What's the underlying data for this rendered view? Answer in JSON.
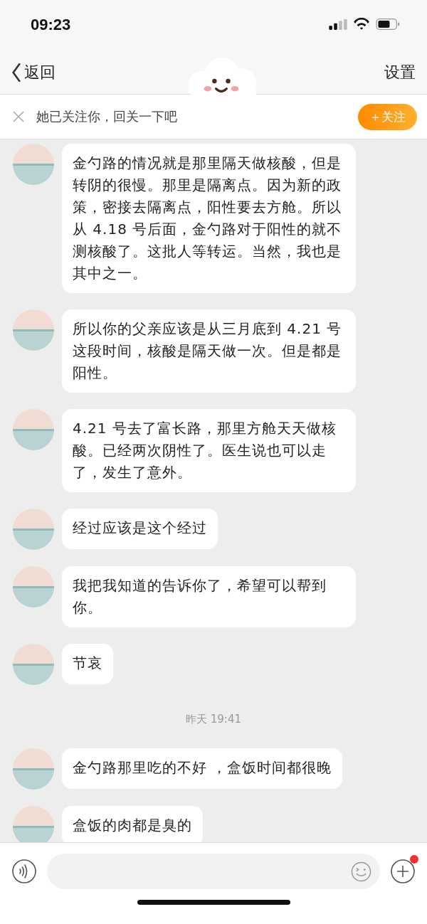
{
  "status_bar": {
    "time": "09:23"
  },
  "nav_bar": {
    "back_label": "返回",
    "settings_label": "设置",
    "title_sticker": true
  },
  "follow_bar": {
    "text": "她已关注你，回关一下吧",
    "button": "＋关注"
  },
  "messages": [
    {
      "kind": "message",
      "text": "金勺路的情况就是那里隔天做核酸，但是转阴的很慢。那里是隔离点。因为新的政策，密接去隔离点，阳性要去方舱。所以从 4.18 号后面，金勺路对于阳性的就不测核酸了。这批人等转运。当然，我也是其中之一。"
    },
    {
      "kind": "message",
      "text": "所以你的父亲应该是从三月底到 4.21 号这段时间，核酸是隔天做一次。但是都是阳性。"
    },
    {
      "kind": "message",
      "text": "4.21 号去了富长路，那里方舱天天做核酸。已经两次阴性了。医生说也可以走了，发生了意外。"
    },
    {
      "kind": "message",
      "text": "经过应该是这个经过"
    },
    {
      "kind": "message",
      "text": "我把我知道的告诉你了，希望可以帮到你。"
    },
    {
      "kind": "message",
      "text": "节哀"
    },
    {
      "kind": "timestamp",
      "text": "昨天 19:41"
    },
    {
      "kind": "message",
      "text": "金勺路那里吃的不好 ，盒饭时间都很晚"
    },
    {
      "kind": "message",
      "text": "盒饭的肉都是臭的"
    }
  ],
  "input_bar": {
    "plus_badge_dot": true
  }
}
